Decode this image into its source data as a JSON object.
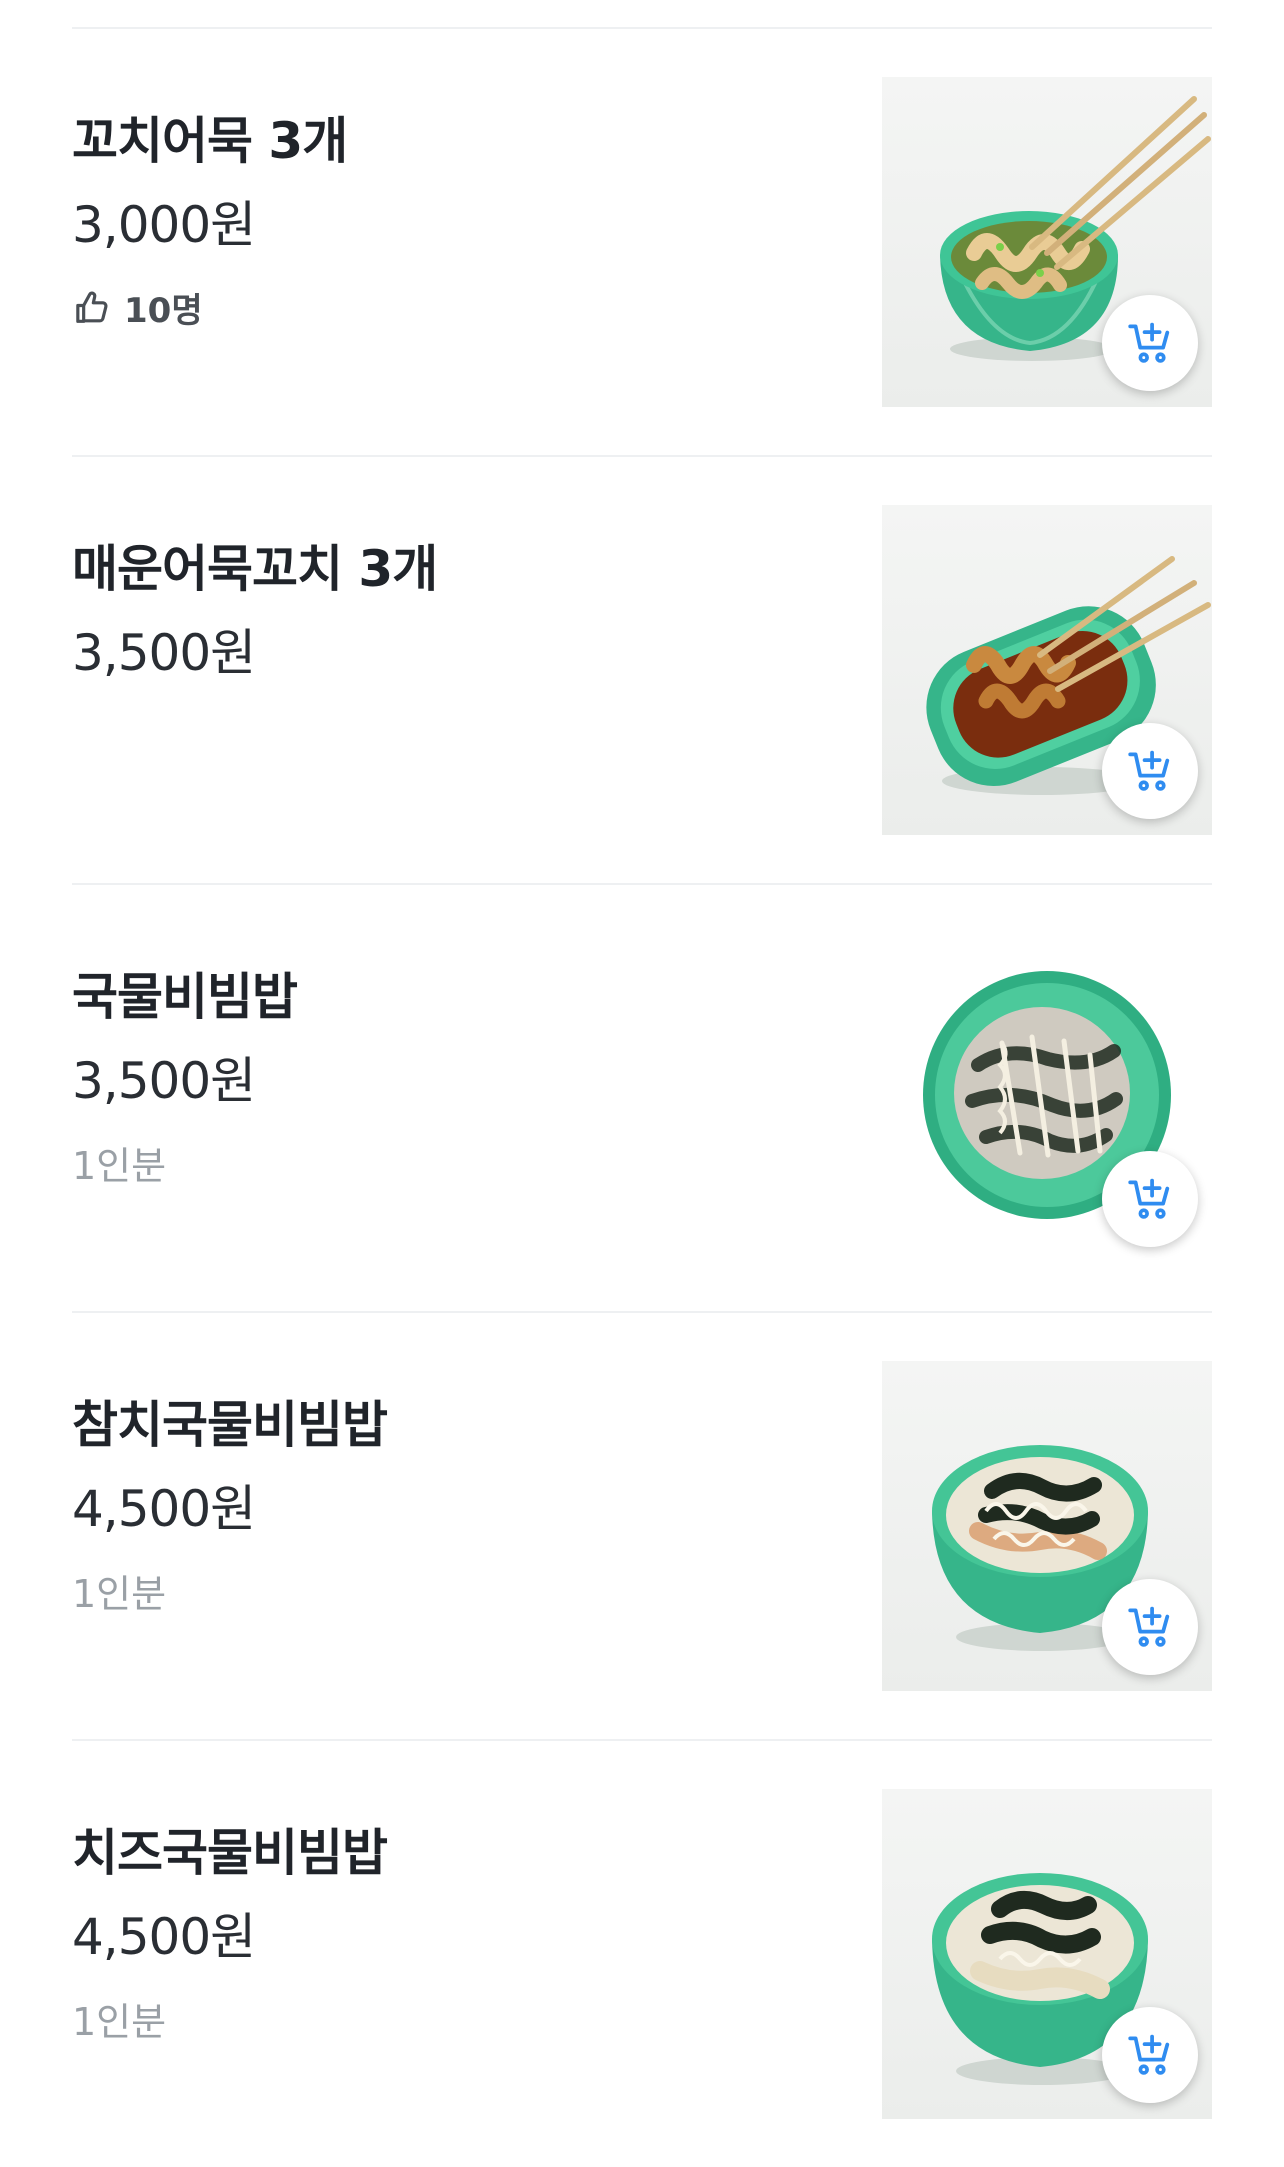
{
  "menu": {
    "items": [
      {
        "name": "꼬치어묵 3개",
        "price": "3,000원",
        "likes": "10명",
        "subtext": "",
        "dish": "fishcake-skewers-broth"
      },
      {
        "name": "매운어묵꼬치 3개",
        "price": "3,500원",
        "likes": "",
        "subtext": "",
        "dish": "spicy-fishcake-skewers"
      },
      {
        "name": "국물비빔밥",
        "price": "3,500원",
        "likes": "",
        "subtext": "1인분",
        "dish": "broth-bibimbap"
      },
      {
        "name": "참치국물비빔밥",
        "price": "4,500원",
        "likes": "",
        "subtext": "1인분",
        "dish": "tuna-broth-bibimbap"
      },
      {
        "name": "치즈국물비빔밥",
        "price": "4,500원",
        "likes": "",
        "subtext": "1인분",
        "dish": "cheese-broth-bibimbap"
      }
    ]
  },
  "icons": {
    "like": "thumbs-up-icon",
    "cart": "add-to-cart-icon"
  },
  "colors": {
    "cart_icon": "#2f8cf0",
    "bowl": "#3fbf93",
    "subtext": "#9aa0a6",
    "divider": "#eef0f2"
  }
}
